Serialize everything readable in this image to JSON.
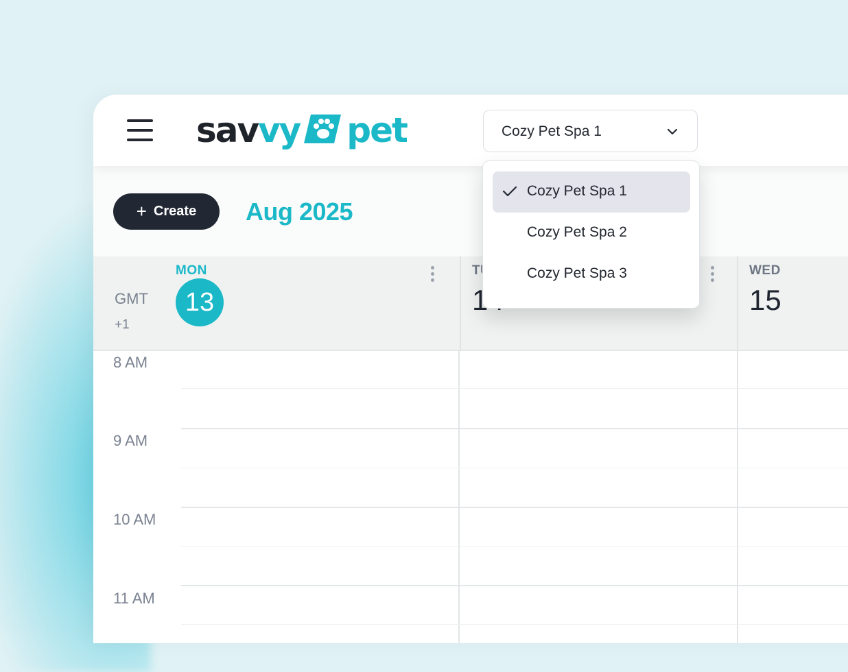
{
  "brand": {
    "logo_part1": "sav",
    "logo_part1b": "vy",
    "logo_part2": "pet",
    "badge_icon": "paw-icon",
    "colors": {
      "dark": "#1f232a",
      "accent": "#1bb8c8"
    }
  },
  "header": {
    "menu_icon": "hamburger-icon",
    "location_select": {
      "value": "Cozy Pet Spa 1",
      "icon": "chevron-down-icon"
    }
  },
  "dropdown": {
    "options": [
      {
        "label": "Cozy Pet Spa 1",
        "selected": true
      },
      {
        "label": "Cozy Pet Spa 2",
        "selected": false
      },
      {
        "label": "Cozy Pet Spa 3",
        "selected": false
      }
    ]
  },
  "toolbar": {
    "create_label": "Create",
    "create_icon": "+",
    "month": "Aug 2025"
  },
  "calendar": {
    "timezone_line1": "GMT",
    "timezone_line2": "+1",
    "days": [
      {
        "dow": "MON",
        "num": "13",
        "today": true
      },
      {
        "dow": "TUE",
        "num": "14",
        "today": false
      },
      {
        "dow": "WED",
        "num": "15",
        "today": false
      }
    ],
    "hours": [
      "8 AM",
      "9 AM",
      "10 AM",
      "11 AM"
    ]
  }
}
